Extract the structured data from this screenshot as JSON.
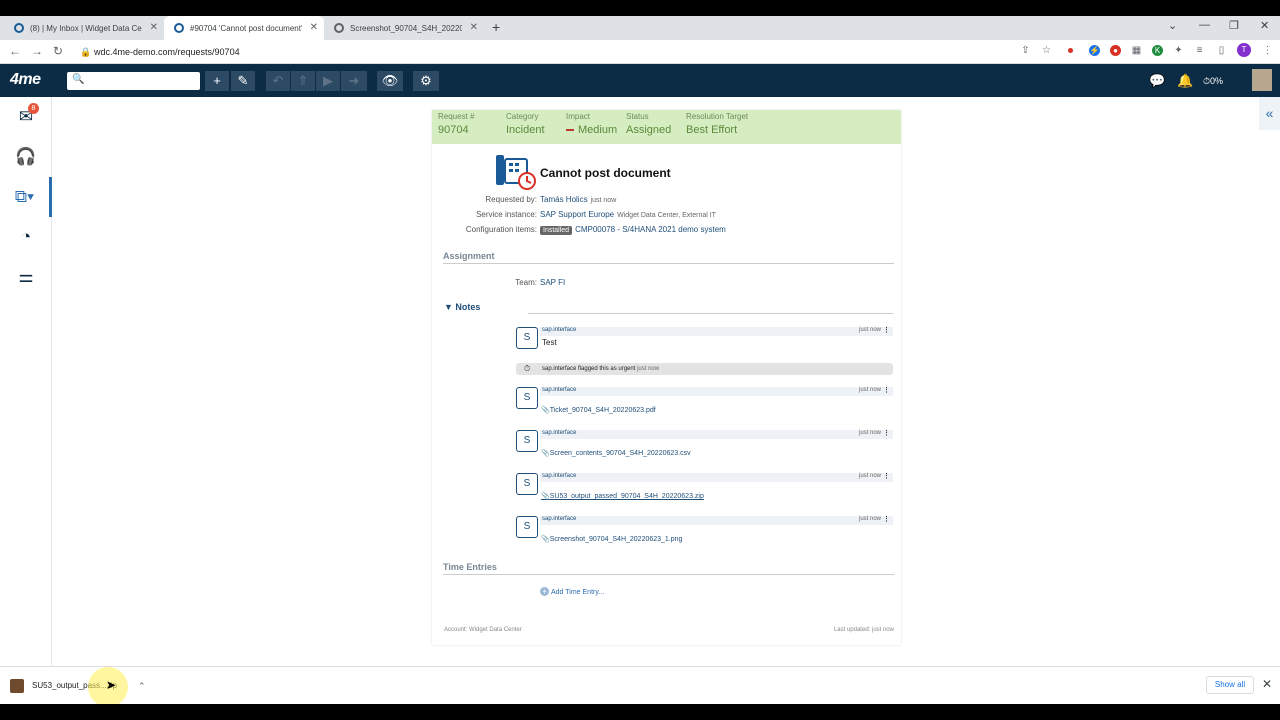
{
  "browser": {
    "tabs": [
      {
        "title": "(8) | My Inbox | Widget Data Cen",
        "active": false
      },
      {
        "title": "#90704 'Cannot post document'",
        "active": true
      },
      {
        "title": "Screenshot_90704_S4H_2022062",
        "active": false
      }
    ],
    "url": "wdc.4me-demo.com/requests/90704",
    "new_tab": "+",
    "profile_initial": "T"
  },
  "app": {
    "logo": "4me",
    "progress": "0%"
  },
  "nav": {
    "inbox_badge": "8"
  },
  "request": {
    "summary": [
      {
        "label": "Request #",
        "value": "90704"
      },
      {
        "label": "Category",
        "value": "Incident"
      },
      {
        "label": "Impact",
        "value": "Medium"
      },
      {
        "label": "Status",
        "value": "Assigned"
      },
      {
        "label": "Resolution Target",
        "value": "Best Effort"
      }
    ],
    "title": "Cannot post document",
    "requested_by_label": "Requested by:",
    "requested_by": "Tamás Holics",
    "requested_when": "just now",
    "service_instance_label": "Service instance:",
    "service_instance": "SAP Support Europe",
    "service_instance_extra": "Widget Data Center, External IT",
    "ci_label": "Configuration items:",
    "ci_status": "Installed",
    "ci_value": "CMP00078 - S/4HANA 2021 demo system",
    "assignment_header": "Assignment",
    "team_label": "Team:",
    "team": "SAP FI",
    "notes_header": "Notes",
    "notes": [
      {
        "avatar": "S",
        "author": "sap.interface",
        "when": "just now",
        "text": "Test"
      },
      {
        "avatar": "S",
        "author": "sap.interface",
        "when": "just now",
        "attachment": "Ticket_90704_S4H_20220623.pdf"
      },
      {
        "avatar": "S",
        "author": "sap.interface",
        "when": "just now",
        "attachment": "Screen_contents_90704_S4H_20220623.csv"
      },
      {
        "avatar": "S",
        "author": "sap.interface",
        "when": "just now",
        "attachment": "SU53_output_passed_90704_S4H_20220623.zip"
      },
      {
        "avatar": "S",
        "author": "sap.interface",
        "when": "just now",
        "attachment": "Screenshot_90704_S4H_20220623_1.png"
      }
    ],
    "flag_text": "sap.interface flagged this as urgent",
    "flag_when": "just now",
    "time_entries_header": "Time Entries",
    "add_time_entry": "Add Time Entry...",
    "account": "Account: Widget Data Center",
    "last_updated": "Last updated: just now"
  },
  "download": {
    "filename": "SU53_output_pass...zip",
    "show_all": "Show all"
  },
  "colors": {
    "header_bg": "#0c2c46",
    "summary_bg": "#d6edc2",
    "link": "#1f4e79"
  }
}
